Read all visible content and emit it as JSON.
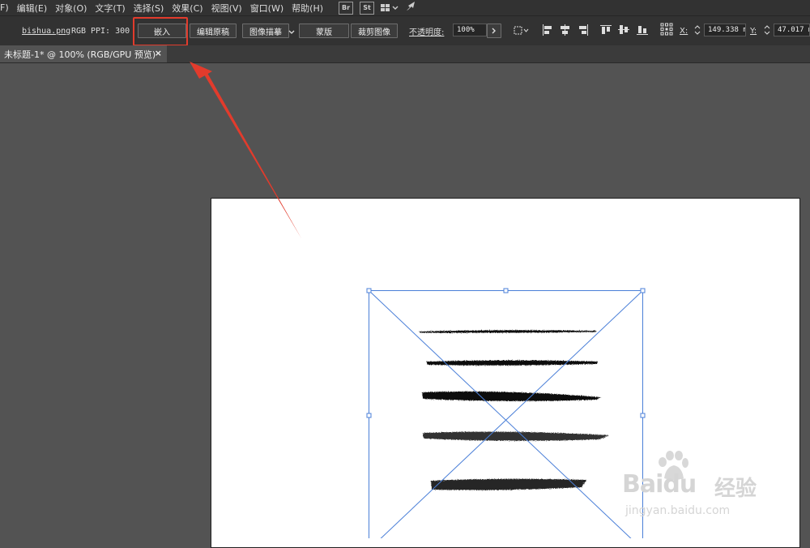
{
  "menu": {
    "items": [
      "F)",
      "编辑(E)",
      "对象(O)",
      "文字(T)",
      "选择(S)",
      "效果(C)",
      "视图(V)",
      "窗口(W)",
      "帮助(H)"
    ],
    "bridge_label": "Br",
    "stock_label": "St"
  },
  "control_bar": {
    "filename": "bishua.png",
    "color_mode": "RGB",
    "ppi": "PPI: 300",
    "embed_label": "嵌入",
    "edit_original_label": "编辑原稿",
    "image_trace_label": "图像描摹",
    "mask_label": "蒙版",
    "crop_label": "裁剪图像",
    "opacity_label": "不透明度:",
    "opacity_value": "100%",
    "x_label": "X:",
    "x_value": "149.338 m",
    "y_label": "Y:",
    "y_value": "47.017 m"
  },
  "document_tab": {
    "title": "未标题-1* @ 100% (RGB/GPU 预览)",
    "close_glyph": "×"
  },
  "watermark": {
    "brand": "Baidu",
    "brand_cn": "经验",
    "url": "jingyan.baidu.com"
  },
  "colors": {
    "annotation_red": "#e23b2c",
    "selection_blue": "#4a7fd8",
    "canvas_bg": "#535353",
    "artboard": "#ffffff"
  }
}
